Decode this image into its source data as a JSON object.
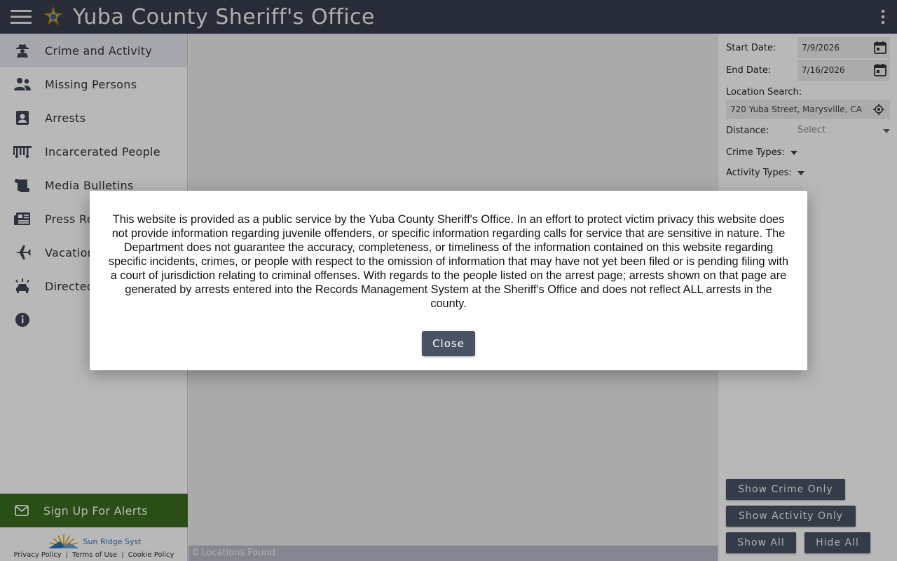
{
  "header": {
    "title": "Yuba County Sheriff's Office",
    "menu_icon": "hamburger-menu-icon",
    "badge_icon": "sheriff-star-badge-icon",
    "more_icon": "kebab-vertical-icon",
    "bg_color": "#373e4e"
  },
  "sidebar": {
    "items": [
      {
        "label": "Crime and Activity",
        "icon": "detective-icon"
      },
      {
        "label": "Missing Persons",
        "icon": "people-icon"
      },
      {
        "label": "Arrests",
        "icon": "id-card-icon"
      },
      {
        "label": "Incarcerated People",
        "icon": "prison-bars-icon"
      },
      {
        "label": "Media Bulletins",
        "icon": "scroll-icon"
      },
      {
        "label": "Press Re",
        "icon": "newspaper-icon"
      },
      {
        "label": "Vacation",
        "icon": "airplane-icon"
      },
      {
        "label": "Directed",
        "icon": "patrol-car-icon"
      },
      {
        "label": "",
        "icon": "info-icon"
      }
    ],
    "alerts_label": "Sign Up For Alerts",
    "alerts_color": "#3a6d1f",
    "brand_name": "Sun Ridge Syst",
    "footer_links": [
      "Privacy Policy",
      "Terms of Use",
      "Cookie Policy"
    ]
  },
  "map": {
    "status": "0 Locations Found"
  },
  "filters": {
    "start_label": "Start Date:",
    "start_value": "7/9/2026",
    "end_label": "End Date:",
    "end_value": "7/16/2026",
    "location_label": "Location Search:",
    "location_value": "720 Yuba Street, Marysville, CA",
    "distance_label": "Distance:",
    "distance_placeholder": "Select",
    "crime_types_label": "Crime Types:",
    "activity_types_label": "Activity Types:",
    "buttons": {
      "crime_only": "Show Crime Only",
      "activity_only": "Show Activity Only",
      "show_all": "Show All",
      "hide_all": "Hide All"
    }
  },
  "modal": {
    "text": "This website is provided as a public service by the Yuba County Sheriff's Office. In an effort to protect victim privacy this website does not provide information regarding juvenile offenders, or specific information regarding calls for service that are sensitive in nature. The Department does not guarantee the accuracy, completeness, or timeliness of the information contained on this website regarding specific incidents, crimes, or people with respect to the omission of information that may have not yet been filed or is pending filing with a court of jurisdiction relating to criminal offenses. With regards to the people listed on the arrest page; arrests shown on that page are generated by arrests entered into the Records Management System at the Sheriff's Office and does not reflect ALL arrests in the county.",
    "close_label": "Close"
  }
}
